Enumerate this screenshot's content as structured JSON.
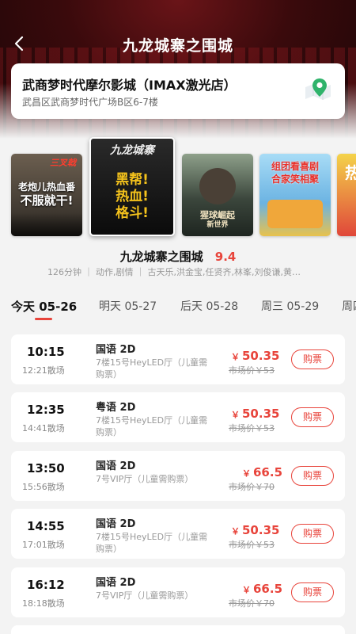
{
  "header": {
    "title": "九龙城寨之围城"
  },
  "cinema": {
    "name": "武商梦时代摩尔影城（IMAX激光店）",
    "address": "武昌区武商梦时代广场B区6-7楼"
  },
  "posters": [
    {
      "line1": "老炮儿热血番",
      "line2": "不服就干!",
      "tag": "三叉戟",
      "bg": "#3b3630"
    },
    {
      "line1": "黑帮!",
      "line2": "热血!",
      "line3": "格斗!",
      "tag": "九龙城寨",
      "bg": "#151515"
    },
    {
      "line1": "猩球崛起",
      "line2": "新世界",
      "bg": "#2f3a33"
    },
    {
      "line1": "组团看喜剧",
      "line2": "合家笑相聚",
      "bg": "#7dc1e8"
    },
    {
      "line1": "热",
      "bg": "#e0473a"
    }
  ],
  "movie": {
    "title": "九龙城寨之围城",
    "score": "9.4",
    "meta": "126分钟 ｜ 动作,剧情 ｜ 古天乐,洪金宝,任贤齐,林峯,刘俊谦,黄德..."
  },
  "dates": [
    {
      "label": "今天 05-26",
      "active": true
    },
    {
      "label": "明天 05-27"
    },
    {
      "label": "后天 05-28"
    },
    {
      "label": "周三 05-29"
    },
    {
      "label": "周四"
    }
  ],
  "shows": [
    {
      "time": "10:15",
      "end": "12:21散场",
      "lang": "国语 2D",
      "hall": "7楼15号HeyLED厅（儿童需购票）",
      "price": "50.35",
      "orig": "市场价￥53",
      "buy": "购票"
    },
    {
      "time": "12:35",
      "end": "14:41散场",
      "lang": "粤语 2D",
      "hall": "7楼15号HeyLED厅（儿童需购票）",
      "price": "50.35",
      "orig": "市场价￥53",
      "buy": "购票"
    },
    {
      "time": "13:50",
      "end": "15:56散场",
      "lang": "国语 2D",
      "hall": "7号VIP厅（儿童需购票）",
      "price": "66.5",
      "orig": "市场价￥70",
      "buy": "购票"
    },
    {
      "time": "14:55",
      "end": "17:01散场",
      "lang": "国语 2D",
      "hall": "7楼15号HeyLED厅（儿童需购票）",
      "price": "50.35",
      "orig": "市场价￥53",
      "buy": "购票"
    },
    {
      "time": "16:12",
      "end": "18:18散场",
      "lang": "国语 2D",
      "hall": "7号VIP厅（儿童需购票）",
      "price": "66.5",
      "orig": "市场价￥70",
      "buy": "购票"
    }
  ],
  "currency": "￥",
  "colors": {
    "accent": "#e8443b",
    "header_bg": "#3a0a0c"
  },
  "icons": {
    "back": "chevron-left-icon",
    "map": "map-pin-icon"
  }
}
